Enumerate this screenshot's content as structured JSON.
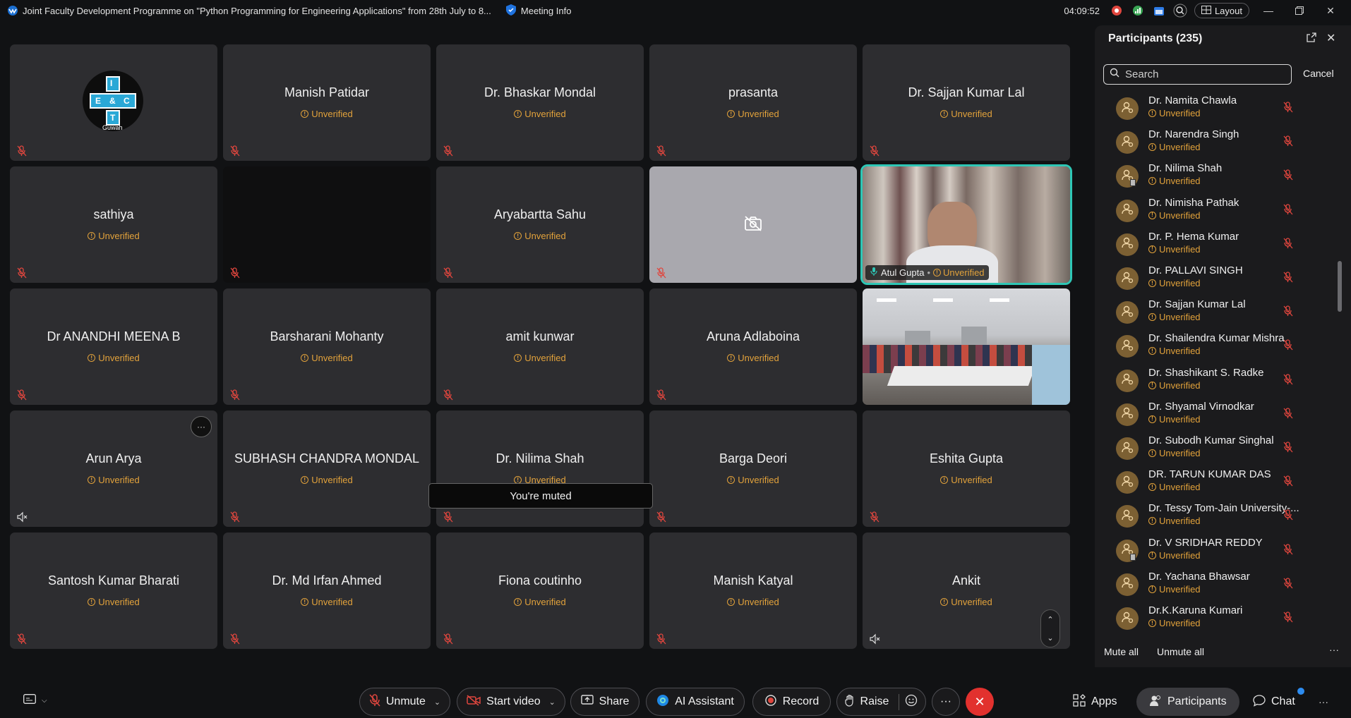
{
  "titlebar": {
    "title": "Joint Faculty Development Programme on \"Python Programming for Engineering Applications\" from 28th July to 8...",
    "meeting_info": "Meeting Info",
    "clock": "04:09:52",
    "layout_label": "Layout"
  },
  "logo_tile": {
    "logo_text": [
      "I",
      "E",
      "&",
      "C",
      "T"
    ],
    "caption": "Guwah"
  },
  "tiles": [
    {
      "name": "",
      "status": ""
    },
    {
      "name": "Manish Patidar",
      "status": "Unverified"
    },
    {
      "name": "Dr. Bhaskar Mondal",
      "status": "Unverified"
    },
    {
      "name": "prasanta",
      "status": "Unverified"
    },
    {
      "name": "Dr. Sajjan Kumar Lal",
      "status": "Unverified"
    },
    {
      "name": "sathiya",
      "status": "Unverified"
    },
    {
      "name": "",
      "status": ""
    },
    {
      "name": "Aryabartta Sahu",
      "status": "Unverified"
    },
    {
      "name": "",
      "status": ""
    },
    {
      "name": "Atul Gupta",
      "status": "Unverified"
    },
    {
      "name": "Dr ANANDHI MEENA B",
      "status": "Unverified"
    },
    {
      "name": "Barsharani Mohanty",
      "status": "Unverified"
    },
    {
      "name": "amit kunwar",
      "status": "Unverified"
    },
    {
      "name": "Aruna Adlaboina",
      "status": "Unverified"
    },
    {
      "name": "",
      "status": ""
    },
    {
      "name": "Arun Arya",
      "status": "Unverified"
    },
    {
      "name": "SUBHASH CHANDRA MONDAL",
      "status": "Unverified"
    },
    {
      "name": "Dr. Nilima Shah",
      "status": "Unverified"
    },
    {
      "name": "Barga Deori",
      "status": "Unverified"
    },
    {
      "name": "Eshita Gupta",
      "status": "Unverified"
    },
    {
      "name": "Santosh Kumar Bharati",
      "status": "Unverified"
    },
    {
      "name": "Dr. Md Irfan Ahmed",
      "status": "Unverified"
    },
    {
      "name": "Fiona coutinho",
      "status": "Unverified"
    },
    {
      "name": "Manish Katyal",
      "status": "Unverified"
    },
    {
      "name": "Ankit",
      "status": "Unverified"
    }
  ],
  "toast": "You're muted",
  "more_label": "···",
  "panel": {
    "title": "Participants (235)",
    "search_placeholder": "Search",
    "cancel": "Cancel",
    "mute_all": "Mute all",
    "unmute_all": "Unmute all",
    "more": "···",
    "participants": [
      {
        "name": "Dr. Namita Chawla",
        "status": "Unverified"
      },
      {
        "name": "Dr. Narendra Singh",
        "status": "Unverified"
      },
      {
        "name": "Dr. Nilima Shah",
        "status": "Unverified"
      },
      {
        "name": "Dr. Nimisha Pathak",
        "status": "Unverified"
      },
      {
        "name": "Dr. P. Hema Kumar",
        "status": "Unverified"
      },
      {
        "name": "Dr. PALLAVI SINGH",
        "status": "Unverified"
      },
      {
        "name": "Dr. Sajjan Kumar Lal",
        "status": "Unverified"
      },
      {
        "name": "Dr. Shailendra Kumar Mishra",
        "status": "Unverified"
      },
      {
        "name": "Dr. Shashikant S. Radke",
        "status": "Unverified"
      },
      {
        "name": "Dr. Shyamal Virnodkar",
        "status": "Unverified"
      },
      {
        "name": "Dr. Subodh Kumar Singhal",
        "status": "Unverified"
      },
      {
        "name": "DR. TARUN KUMAR DAS",
        "status": "Unverified"
      },
      {
        "name": "Dr. Tessy Tom-Jain University-...",
        "status": "Unverified"
      },
      {
        "name": "Dr. V SRIDHAR REDDY",
        "status": "Unverified"
      },
      {
        "name": "Dr. Yachana Bhawsar",
        "status": "Unverified"
      },
      {
        "name": "Dr.K.Karuna Kumari",
        "status": "Unverified"
      }
    ]
  },
  "controls": {
    "unmute": "Unmute",
    "start_video": "Start video",
    "share": "Share",
    "ai_assistant": "AI Assistant",
    "record": "Record",
    "raise": "Raise",
    "apps": "Apps",
    "participants": "Participants",
    "chat": "Chat"
  },
  "colors": {
    "unverified": "#e2a23b",
    "mute_red": "#e0463e",
    "active_speaker": "#2ec7b6",
    "leave": "#e2312e"
  }
}
